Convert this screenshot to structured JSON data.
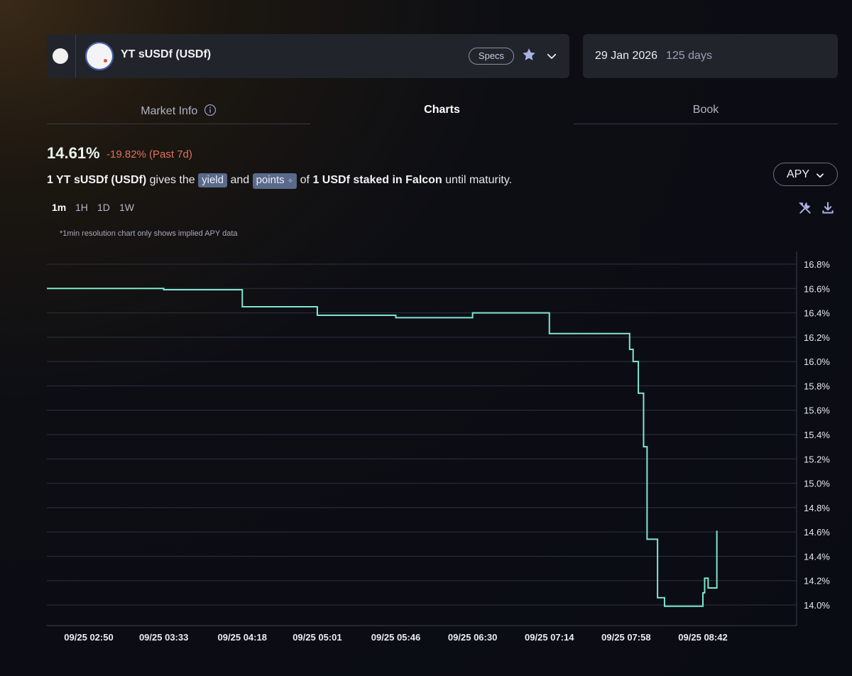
{
  "header": {
    "market_name": "YT sUSDf (USDf)",
    "specs_label": "Specs",
    "maturity_date": "29 Jan 2026",
    "days_left": "125 days"
  },
  "tabs": [
    {
      "label": "Market Info",
      "active": false
    },
    {
      "label": "Charts",
      "active": true
    },
    {
      "label": "Book",
      "active": false
    }
  ],
  "summary": {
    "apy": "14.61%",
    "change": "-19.82% (Past 7d)",
    "desc_prefix": "1 YT sUSDf (USDf)",
    "desc_gives": "gives the",
    "chip_yield": "yield",
    "desc_and": "and",
    "chip_points": "points",
    "desc_of": "of",
    "desc_staked": "1 USDf staked in Falcon",
    "desc_until": "until maturity."
  },
  "controls": {
    "metric_select": "APY",
    "resolutions": [
      "1m",
      "1H",
      "1D",
      "1W"
    ],
    "active_resolution": "1m",
    "note": "*1min resolution chart only shows implied APY data"
  },
  "colors": {
    "line": "#7ee6cf",
    "negative": "#e0705e",
    "panel": "#22242c",
    "grid": "#2e3340"
  },
  "chart_data": {
    "type": "line",
    "series": [
      {
        "points": [
          [
            "09/25 02:50",
            16.6
          ],
          [
            "09/25 03:33",
            16.59
          ],
          [
            "09/25 04:18",
            16.45
          ],
          [
            "09/25 05:01",
            16.38
          ],
          [
            "09/25 05:46",
            16.36
          ],
          [
            "09/25 06:30",
            16.4
          ],
          [
            "09/25 07:14",
            16.23
          ],
          [
            "09/25 07:58",
            16.23
          ],
          [
            "09/25 08:00",
            16.1
          ],
          [
            "09/25 08:02",
            16.0
          ],
          [
            "09/25 08:05",
            15.74
          ],
          [
            "09/25 08:08",
            15.3
          ],
          [
            "09/25 08:10",
            14.54
          ],
          [
            "09/25 08:16",
            14.06
          ],
          [
            "09/25 08:20",
            13.99
          ],
          [
            "09/25 08:42",
            14.1
          ],
          [
            "09/25 08:43",
            14.22
          ],
          [
            "09/25 08:45",
            14.14
          ],
          [
            "09/25 08:50",
            14.61
          ]
        ]
      }
    ],
    "x_ticks": [
      "09/25 02:50",
      "09/25 03:33",
      "09/25 04:18",
      "09/25 05:01",
      "09/25 05:46",
      "09/25 06:30",
      "09/25 07:14",
      "09/25 07:58",
      "09/25 08:42"
    ],
    "y_ticks": [
      "16.8%",
      "16.6%",
      "16.4%",
      "16.2%",
      "16.0%",
      "15.8%",
      "15.6%",
      "15.4%",
      "15.2%",
      "15.0%",
      "14.8%",
      "14.6%",
      "14.4%",
      "14.2%",
      "14.0%"
    ],
    "ylim": [
      13.8,
      16.9
    ],
    "grid": true,
    "y_axis_position": "right"
  }
}
